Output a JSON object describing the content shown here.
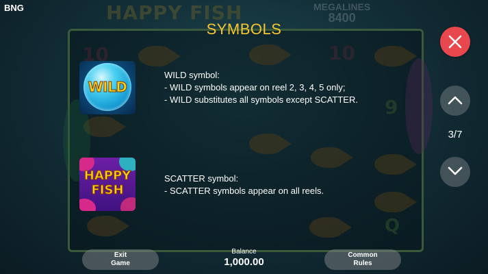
{
  "brand": "BNG",
  "background": {
    "game_title": "HAPPY FISH",
    "megalines_label": "MEGALINES",
    "megalines_value": "8400"
  },
  "page": {
    "title": "SYMBOLS",
    "current": 3,
    "total": 7,
    "counter": "3/7"
  },
  "symbols": [
    {
      "icon": "wild-symbol-icon",
      "tile_text": "WILD",
      "heading": "WILD symbol:",
      "lines": [
        "- WILD symbols appear on reel 2, 3, 4, 5 only;",
        "- WILD substitutes all symbols except SCATTER."
      ]
    },
    {
      "icon": "scatter-symbol-icon",
      "tile_text": [
        "HAPPY",
        "FISH"
      ],
      "heading": "SCATTER symbol:",
      "lines": [
        "- SCATTER symbols appear on all reels."
      ]
    }
  ],
  "controls": {
    "close_icon": "close-icon",
    "up_icon": "chevron-up-icon",
    "down_icon": "chevron-down-icon"
  },
  "footer": {
    "exit_line1": "Exit",
    "exit_line2": "Game",
    "balance_label": "Balance",
    "balance_value": "1,000.00",
    "rules_line1": "Common",
    "rules_line2": "Rules"
  },
  "colors": {
    "title": "#f5c431",
    "close_button": "#e8484d",
    "nav_button": "#6e767c"
  }
}
